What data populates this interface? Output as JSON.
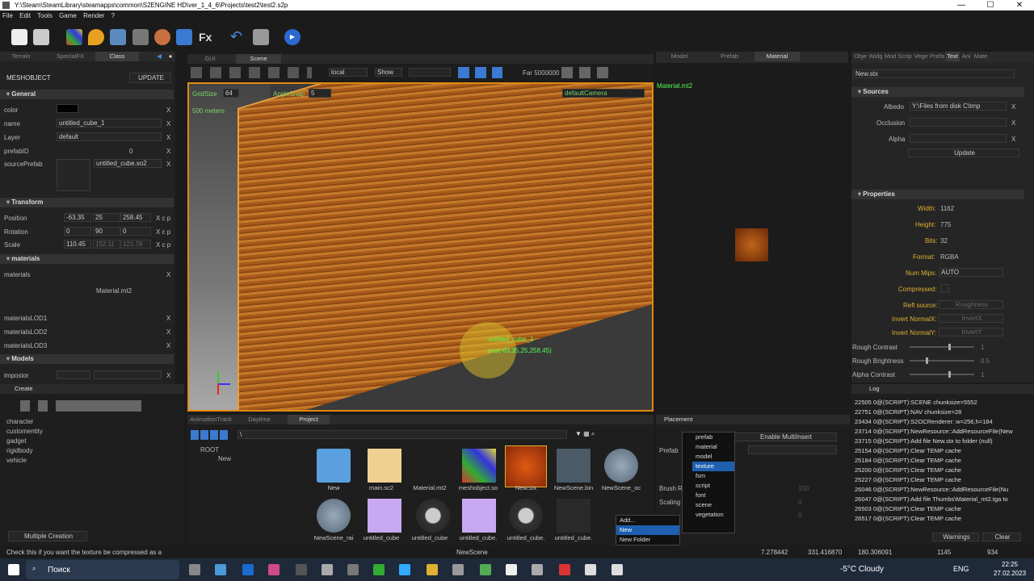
{
  "window": {
    "title": "Y:\\Steam\\SteamLibrary\\steamapps\\common\\S2ENGINE HD\\ver_1_4_6\\Projects\\test2\\test2.s2p",
    "minimize": "—",
    "maximize": "☐",
    "close": "✕"
  },
  "menu": [
    "File",
    "Edit",
    "Tools",
    "Game",
    "Render",
    "?"
  ],
  "left": {
    "tabs": [
      "Terrain",
      "SpecialFX",
      "Class"
    ],
    "object_label": "MESHOBJECT",
    "update_label": "UPDATE",
    "general": "General",
    "color": "color",
    "name": "name",
    "name_value": "untitled_cube_1",
    "layer": "Layer",
    "layer_value": "default",
    "prefabid": "prefabID",
    "prefabid_value": "0",
    "sourceprefab": "sourcePrefab",
    "sourceprefab_value": "untitled_cube.so2",
    "transform": "Transform",
    "position": "Position",
    "pos": [
      "-63.35",
      "25",
      "258.45"
    ],
    "rotation": "Rotation",
    "rot": [
      "0",
      "90",
      "0"
    ],
    "scale": "Scale",
    "scl": [
      "110.45",
      "152.11",
      "121.78"
    ],
    "materials_sec": "materials",
    "materials": "materials",
    "material_value": "Material.mt2",
    "lod1": "materialsLOD1",
    "lod2": "materialsLOD2",
    "lod3": "materialsLOD3",
    "models": "Models",
    "impostor": "impostor"
  },
  "create": {
    "title": "Create",
    "items": [
      "character",
      "customentity",
      "gadget",
      "rigidbody",
      "vehicle"
    ],
    "multiple": "Multiple Creation"
  },
  "scene": {
    "tabs": [
      "GUI",
      "Scene"
    ],
    "local": "local",
    "show": "Show",
    "far": "Far 5000000",
    "gridsize": "GridSize",
    "gridsize_value": "64",
    "anglesnap": "AngleSnap",
    "anglesnap_value": "5",
    "meters": "500 meters",
    "camera": "defaultCamera",
    "obj_label": "untitled_cube_1",
    "obj_pos": "pos(-63.35,25,258.45)"
  },
  "project": {
    "tabs": [
      "AnimationTrack",
      "Daytime",
      "Project"
    ],
    "path": "\\",
    "tree": [
      "ROOT",
      "New"
    ],
    "row1": [
      "New",
      "main.sc2",
      "Material.mt2",
      "meshobject.so",
      "New.stx",
      "NewScene.bin",
      "NewScene_oc"
    ],
    "row2": [
      "NewScene_rai",
      "untitled_cube",
      "untitled_cube",
      "untitled_cube.",
      "untitled_cube.",
      "untitled_cube."
    ]
  },
  "material": {
    "tabs": [
      "Model",
      "Prefab",
      "Material"
    ],
    "file": "Material.mt2"
  },
  "placement": {
    "title": "Placement",
    "enable": "Enable MultiInsert",
    "prefab": "Prefab",
    "brush": "Brush R",
    "scaling": "Scaling",
    "val": "100",
    "zero1": "0",
    "zero2": "0"
  },
  "ctx_menu": {
    "add": "Add...",
    "new": "New",
    "new_folder": "New Folder"
  },
  "sub_menu": [
    "prefab",
    "material",
    "model",
    "texture",
    "fsm",
    "script",
    "font",
    "scene",
    "vegetation"
  ],
  "inspector": {
    "tabs": [
      "Obje",
      "Widg",
      "Mod",
      "Scrip",
      "Vege",
      "Prefa",
      "Text",
      "Ani",
      "Mate"
    ],
    "file": "New.stx",
    "sources": "Sources",
    "albedo": "Albedo",
    "albedo_value": "Y:\\Files from disk C\\tmp",
    "occlusion": "Occlusion",
    "alpha": "Alpha",
    "update": "Update",
    "properties": "Properties",
    "width": "Width:",
    "width_value": "1162",
    "height": "Height:",
    "height_value": "775",
    "bits": "Bits:",
    "bits_value": "32",
    "format": "Format:",
    "format_value": "RGBA",
    "nummips": "Num Mips:",
    "nummips_value": "AUTO",
    "compressed": "Compressed:",
    "reflsource": "Refl source:",
    "reflsource_value": "Roughness",
    "invx": "Invert NormalX:",
    "invx_value": "InvertX",
    "invy": "Invert NormalY:",
    "invy_value": "InvertY",
    "rc": "Rough Contrast",
    "rc_value": "1",
    "rb": "Rough Brightness",
    "rb_value": "0.5",
    "ac": "Alpha Contrast",
    "ac_value": "1"
  },
  "log": {
    "title": "Log",
    "lines": [
      "22505 0@(SCRIPT):SCENE chunksize=5552",
      "22751 0@(SCRIPT):NAV chunksize=28",
      "23434 0@(SCRIPT):S2OCRenderer: w=256,h=184",
      "23714 0@(SCRIPT):NewResource::AddResourceFile(New",
      "23715 0@(SCRIPT):Add file New.stx to folder (null)",
      "25154 0@(SCRIPT):Clear TEMP cache",
      "25184 0@(SCRIPT):Clear TEMP cache",
      "25200 0@(SCRIPT):Clear TEMP cache",
      "25227 0@(SCRIPT):Clear TEMP cache",
      "26046 0@(SCRIPT):NewResource::AddResourceFile(Nu",
      "26047 0@(SCRIPT):Add file Thumbs\\Material_mt2.tga to",
      "26503 0@(SCRIPT):Clear TEMP cache",
      "26517 0@(SCRIPT):Clear TEMP cache"
    ],
    "warnings": "Warnings",
    "clear": "Clear"
  },
  "status": {
    "hint": "Check this if you want the texture be compressed as a",
    "scene": "NewScene",
    "c1": "7.278442",
    "c2": "331.416870",
    "c3": "180.306091",
    "c4": "1145",
    "c5": "934"
  },
  "taskbar": {
    "search": "Поиск",
    "weather": "-5°C Cloudy",
    "lang": "ENG",
    "time": "22:25",
    "date": "27.02.2023"
  }
}
